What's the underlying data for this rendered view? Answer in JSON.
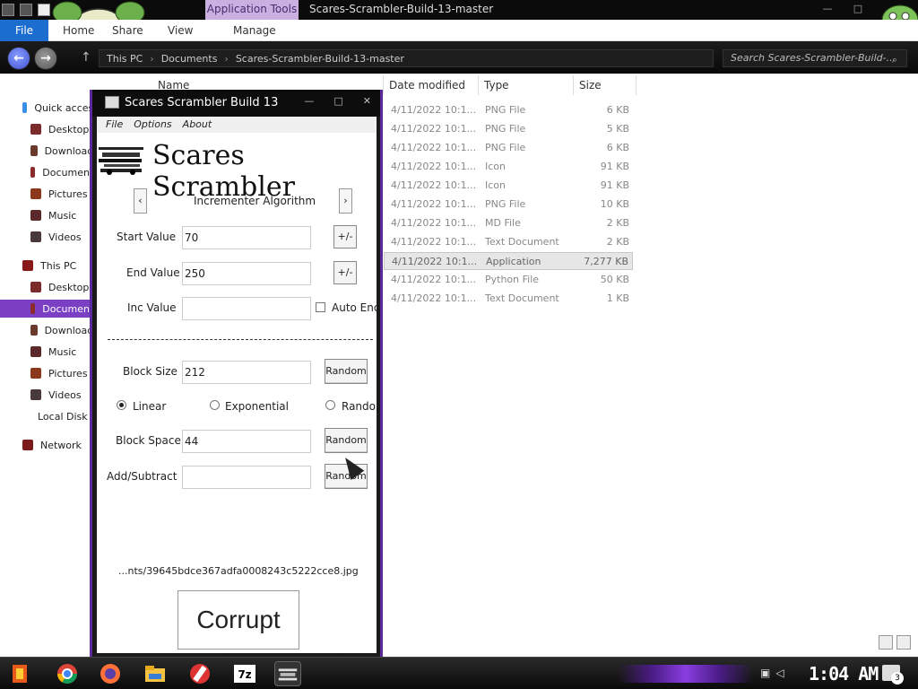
{
  "explorer": {
    "title": "Scares-Scrambler-Build-13-master",
    "context_tab": "Application Tools",
    "ribbon_tabs": {
      "file": "File",
      "home": "Home",
      "share": "Share",
      "view": "View",
      "manage": "Manage"
    },
    "breadcrumbs": [
      "This PC",
      "Documents",
      "Scares-Scrambler-Build-13-master"
    ],
    "search_placeholder": "Search Scares-Scrambler-Build-...",
    "columns": {
      "name": "Name",
      "date": "Date modified",
      "type": "Type",
      "size": "Size"
    },
    "nav": [
      {
        "label": "Quick access",
        "icon": "star-icon",
        "color": "#3a8ee6",
        "indent": 0
      },
      {
        "label": "Desktop",
        "icon": "desktop-icon",
        "color": "#7a2a2a",
        "indent": 1
      },
      {
        "label": "Downloads",
        "icon": "downloads-icon",
        "color": "#6a3a2a",
        "indent": 1
      },
      {
        "label": "Documents",
        "icon": "documents-icon",
        "color": "#8a2a2a",
        "indent": 1
      },
      {
        "label": "Pictures",
        "icon": "pictures-icon",
        "color": "#8a3a1a",
        "indent": 1
      },
      {
        "label": "Music",
        "icon": "music-icon",
        "color": "#5a2a2a",
        "indent": 1
      },
      {
        "label": "Videos",
        "icon": "videos-icon",
        "color": "#4a3a3a",
        "indent": 1
      },
      {
        "label": "This PC",
        "icon": "this-pc-icon",
        "color": "#8a1a1a",
        "indent": 0
      },
      {
        "label": "Desktop",
        "icon": "desktop-icon",
        "color": "#7a2a2a",
        "indent": 1
      },
      {
        "label": "Documents",
        "icon": "documents-icon",
        "color": "#8a2a2a",
        "indent": 1
      },
      {
        "label": "Downloads",
        "icon": "downloads-icon",
        "color": "#6a3a2a",
        "indent": 1
      },
      {
        "label": "Music",
        "icon": "music-icon",
        "color": "#5a2a2a",
        "indent": 1
      },
      {
        "label": "Pictures",
        "icon": "pictures-icon",
        "color": "#8a3a1a",
        "indent": 1
      },
      {
        "label": "Videos",
        "icon": "videos-icon",
        "color": "#4a3a3a",
        "indent": 1
      },
      {
        "label": "Local Disk (C:)",
        "icon": "local-disk-icon",
        "color": "#5a2a2a",
        "indent": 1
      },
      {
        "label": "Network",
        "icon": "network-icon",
        "color": "#7a1a1a",
        "indent": 0
      }
    ],
    "selected_nav_index": 9,
    "files": [
      {
        "date": "4/11/2022 10:1...",
        "type": "PNG File",
        "size": "6 KB"
      },
      {
        "date": "4/11/2022 10:1...",
        "type": "PNG File",
        "size": "5 KB"
      },
      {
        "date": "4/11/2022 10:1...",
        "type": "PNG File",
        "size": "6 KB"
      },
      {
        "date": "4/11/2022 10:1...",
        "type": "Icon",
        "size": "91 KB"
      },
      {
        "date": "4/11/2022 10:1...",
        "type": "Icon",
        "size": "91 KB"
      },
      {
        "date": "4/11/2022 10:1...",
        "type": "PNG File",
        "size": "10 KB"
      },
      {
        "date": "4/11/2022 10:1...",
        "type": "MD File",
        "size": "2 KB"
      },
      {
        "date": "4/11/2022 10:1...",
        "type": "Text Document",
        "size": "2 KB"
      },
      {
        "date": "4/11/2022 10:1...",
        "type": "Application",
        "size": "7,277 KB"
      },
      {
        "date": "4/11/2022 10:1...",
        "type": "Python File",
        "size": "50 KB"
      },
      {
        "date": "4/11/2022 10:1...",
        "type": "Text Document",
        "size": "1 KB"
      }
    ],
    "selected_file_index": 8
  },
  "scrambler": {
    "title": "Scares Scrambler Build 13",
    "menu": {
      "file": "File",
      "options": "Options",
      "about": "About"
    },
    "logo": "Scares Scrambler",
    "algorithm": "Incrementer Algorithm",
    "start_label": "Start Value",
    "start_value": "70",
    "end_label": "End Value",
    "end_value": "250",
    "inc_label": "Inc Value",
    "inc_value": "",
    "auto_end_label": "Auto End",
    "plusminus": "+/-",
    "block_size_label": "Block Size",
    "block_size": "212",
    "random_label": "Random",
    "linear_label": "Linear",
    "exponential_label": "Exponential",
    "random_mode_label": "Random",
    "block_space_label": "Block Space",
    "block_space": "44",
    "add_sub_label": "Add/Subtract",
    "add_sub_value": "",
    "file_path": "...nts/39645bdce367adfa0008243c5222cce8.jpg",
    "corrupt_label": "Corrupt"
  },
  "taskbar": {
    "clock": "1:04 AM",
    "notification_count": "3",
    "apps": [
      "start-icon",
      "chrome-icon",
      "firefox-icon",
      "file-explorer-icon",
      "paint-icon",
      "7zip-icon",
      "scrambler-icon"
    ]
  }
}
